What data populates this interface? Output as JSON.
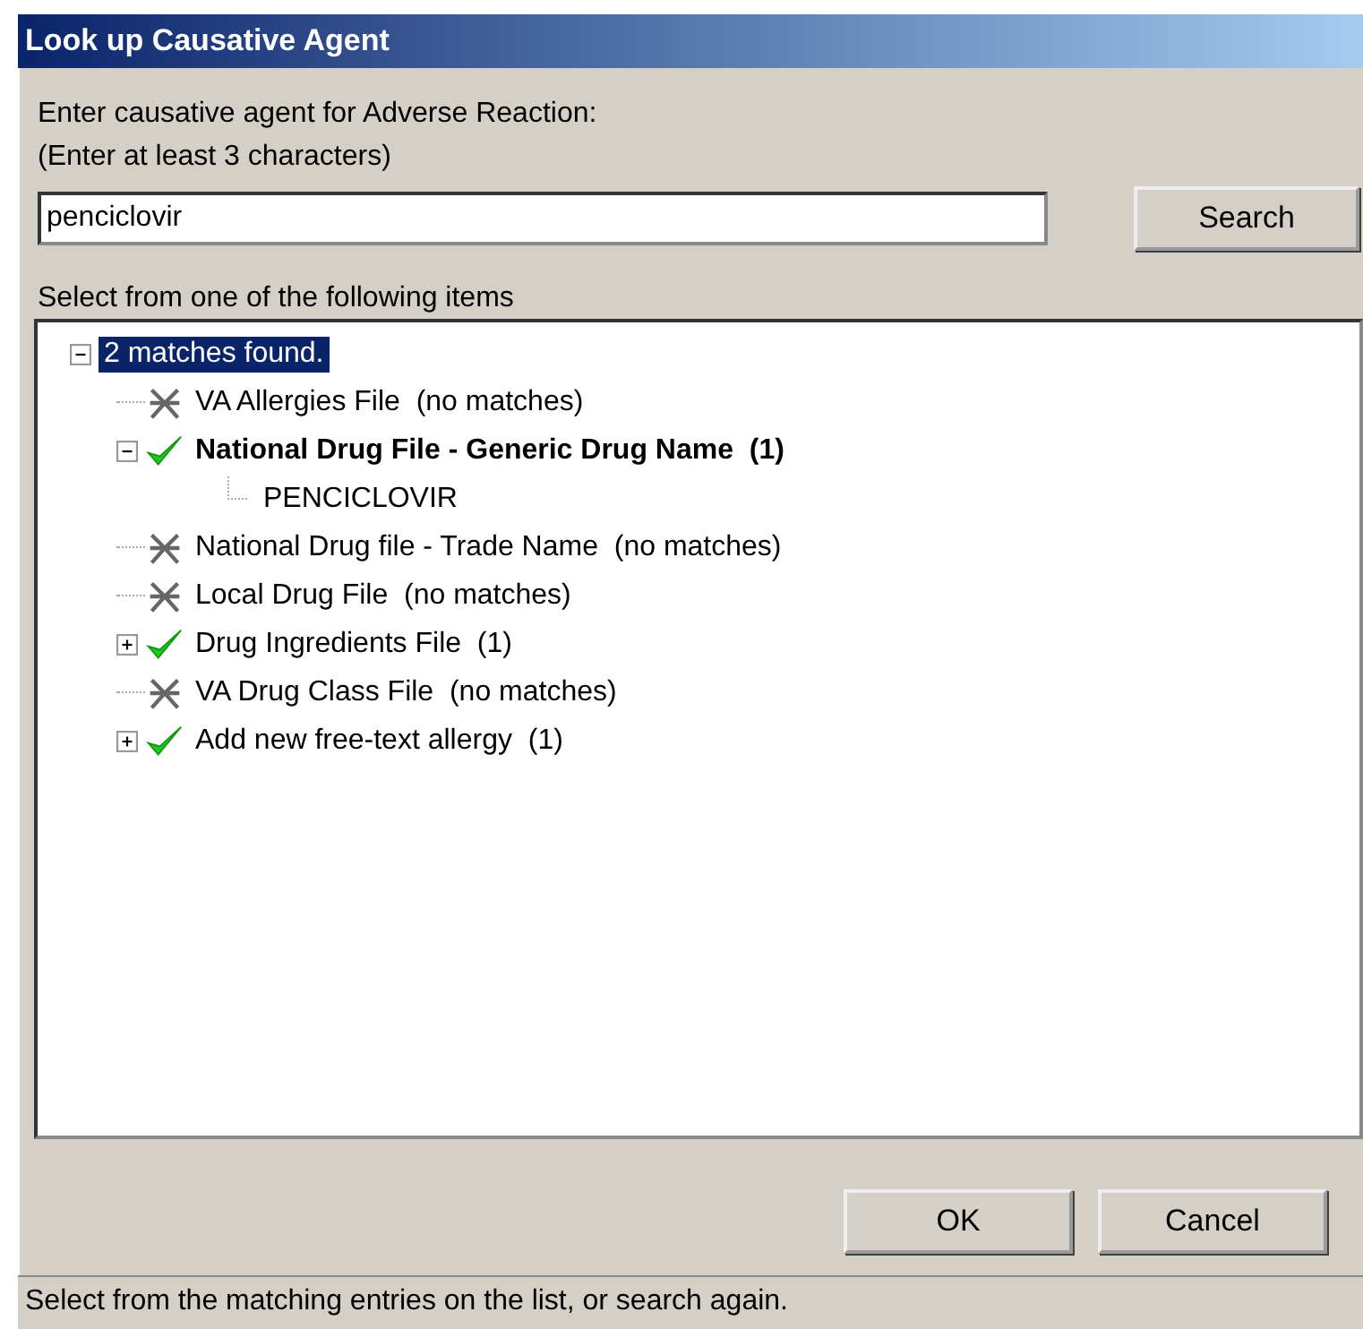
{
  "window": {
    "title": "Look up Causative Agent"
  },
  "prompt": {
    "lines": [
      "Enter causative agent for Adverse Reaction:",
      "(Enter at least 3 characters)"
    ]
  },
  "search_field": {
    "value": "penciclovir"
  },
  "search_button": "Search",
  "list_label": "Select from one of the following items",
  "tree": {
    "label": "2 matches found.",
    "selected": true,
    "expanded": true,
    "children": [
      {
        "label": "VA Allergies File  (no matches)",
        "kind": "nomatch",
        "selected": false,
        "bold": false
      },
      {
        "label": "National Drug File - Generic Drug Name  (1)",
        "kind": "match",
        "selected": false,
        "bold": true,
        "expanded": true,
        "children": [
          {
            "label": "PENCICLOVIR",
            "selected": false
          }
        ]
      },
      {
        "label": "National Drug file - Trade Name  (no matches)",
        "kind": "nomatch",
        "selected": false,
        "bold": false
      },
      {
        "label": "Local Drug File  (no matches)",
        "kind": "nomatch",
        "selected": false,
        "bold": false
      },
      {
        "label": "Drug Ingredients File  (1)",
        "kind": "match",
        "selected": false,
        "bold": false,
        "expanded": false
      },
      {
        "label": "VA Drug Class File  (no matches)",
        "kind": "nomatch",
        "selected": false,
        "bold": false
      },
      {
        "label": "Add new free-text allergy  (1)",
        "kind": "match",
        "selected": false,
        "bold": false,
        "expanded": false
      }
    ]
  },
  "buttons": [
    "OK",
    "Cancel"
  ],
  "status_bar": "Select from the matching entries on the list, or search again."
}
